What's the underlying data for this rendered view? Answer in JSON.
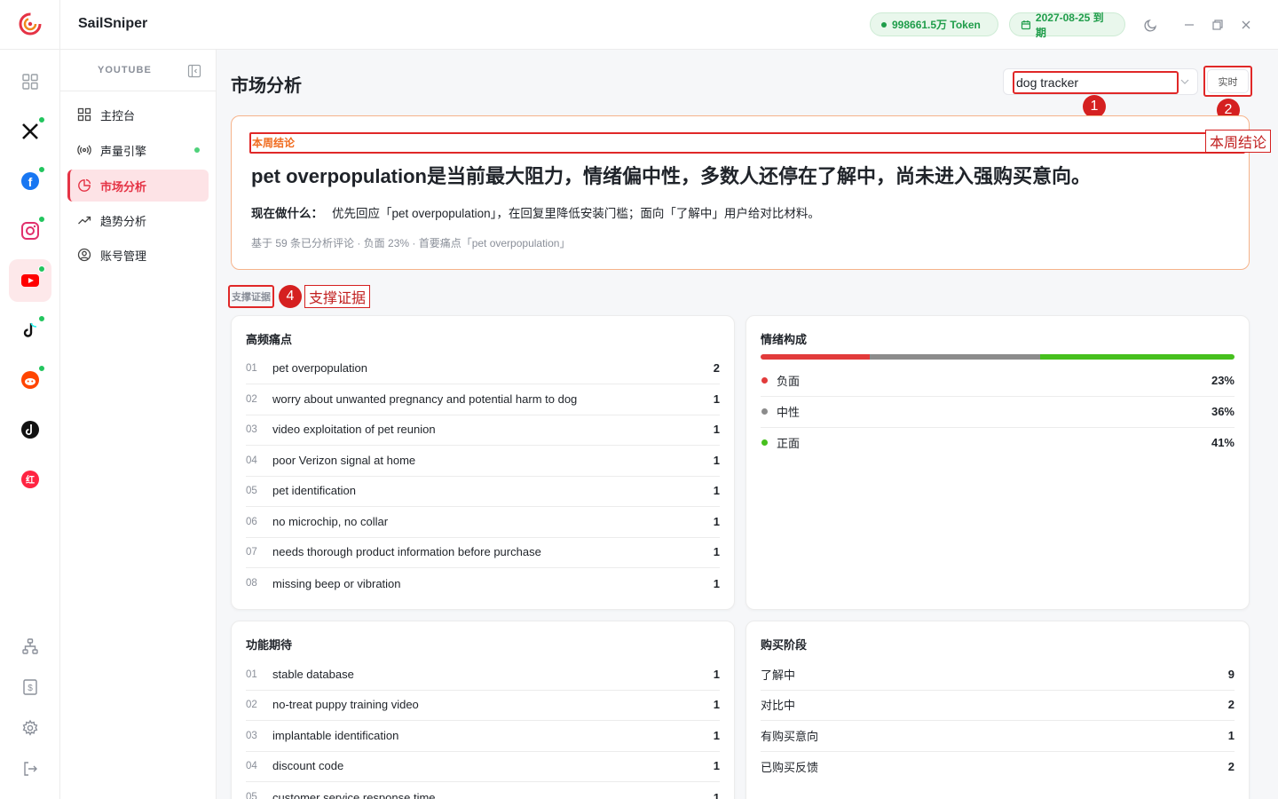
{
  "app": {
    "title": "SailSniper"
  },
  "topbar": {
    "token_label": "998661.5万 Token",
    "expire_label": "2027-08-25 到期"
  },
  "rail": {
    "platforms": [
      {
        "name": "x",
        "online": true
      },
      {
        "name": "facebook",
        "online": true
      },
      {
        "name": "instagram",
        "online": true
      },
      {
        "name": "youtube",
        "online": true,
        "active": true
      },
      {
        "name": "tiktok",
        "online": true
      },
      {
        "name": "reddit",
        "online": true
      },
      {
        "name": "tiktok-alt",
        "online": false
      },
      {
        "name": "xiaohongshu",
        "online": false
      }
    ]
  },
  "subnav": {
    "section": "YOUTUBE",
    "items": [
      {
        "label": "主控台",
        "icon": "dashboard-icon"
      },
      {
        "label": "声量引擎",
        "icon": "broadcast-icon"
      },
      {
        "label": "市场分析",
        "icon": "pie-chart-icon",
        "active": true
      },
      {
        "label": "趋势分析",
        "icon": "trend-icon"
      },
      {
        "label": "账号管理",
        "icon": "account-icon"
      }
    ]
  },
  "main": {
    "title": "市场分析",
    "search": {
      "value": "dog tracker"
    },
    "realtime_label": "实时",
    "markers": {
      "m1": "1",
      "m2": "2",
      "m4": "4"
    },
    "callouts": {
      "c2": "本周结论",
      "c4": "支撑证据"
    },
    "conclusion": {
      "header": "本周结论",
      "headline": "pet overpopulation是当前最大阻力，情绪偏中性，多数人还停在了解中，尚未进入强购买意向。",
      "todo_label": "现在做什么：",
      "todo_text": "优先回应「pet overpopulation」，在回复里降低安装门槛；面向「了解中」用户给对比材料。",
      "meta": "基于 59 条已分析评论 · 负面 23% · 首要痛点「pet overpopulation」"
    },
    "evidence_label": "支撑证据",
    "pain_points": {
      "title": "高频痛点",
      "items": [
        {
          "idx": "01",
          "text": "pet overpopulation",
          "count": "2"
        },
        {
          "idx": "02",
          "text": "worry about unwanted pregnancy and potential harm to dog",
          "count": "1"
        },
        {
          "idx": "03",
          "text": "video exploitation of pet reunion",
          "count": "1"
        },
        {
          "idx": "04",
          "text": "poor Verizon signal at home",
          "count": "1"
        },
        {
          "idx": "05",
          "text": "pet identification",
          "count": "1"
        },
        {
          "idx": "06",
          "text": "no microchip, no collar",
          "count": "1"
        },
        {
          "idx": "07",
          "text": "needs thorough product information before purchase",
          "count": "1"
        },
        {
          "idx": "08",
          "text": "missing beep or vibration",
          "count": "1"
        }
      ]
    },
    "sentiment": {
      "title": "情绪构成",
      "items": [
        {
          "label": "负面",
          "pct": "23%",
          "value": 23,
          "color": "#e23b3b"
        },
        {
          "label": "中性",
          "pct": "36%",
          "value": 36,
          "color": "#8c8c8c"
        },
        {
          "label": "正面",
          "pct": "41%",
          "value": 41,
          "color": "#46c01e"
        }
      ]
    },
    "features": {
      "title": "功能期待",
      "items": [
        {
          "idx": "01",
          "text": "stable database",
          "count": "1"
        },
        {
          "idx": "02",
          "text": "no-treat puppy training video",
          "count": "1"
        },
        {
          "idx": "03",
          "text": "implantable identification",
          "count": "1"
        },
        {
          "idx": "04",
          "text": "discount code",
          "count": "1"
        },
        {
          "idx": "05",
          "text": "customer service response time",
          "count": "1"
        }
      ]
    },
    "stages": {
      "title": "购买阶段",
      "items": [
        {
          "text": "了解中",
          "count": "9"
        },
        {
          "text": "对比中",
          "count": "2"
        },
        {
          "text": "有购买意向",
          "count": "1"
        },
        {
          "text": "已购买反馈",
          "count": "2"
        }
      ]
    }
  }
}
